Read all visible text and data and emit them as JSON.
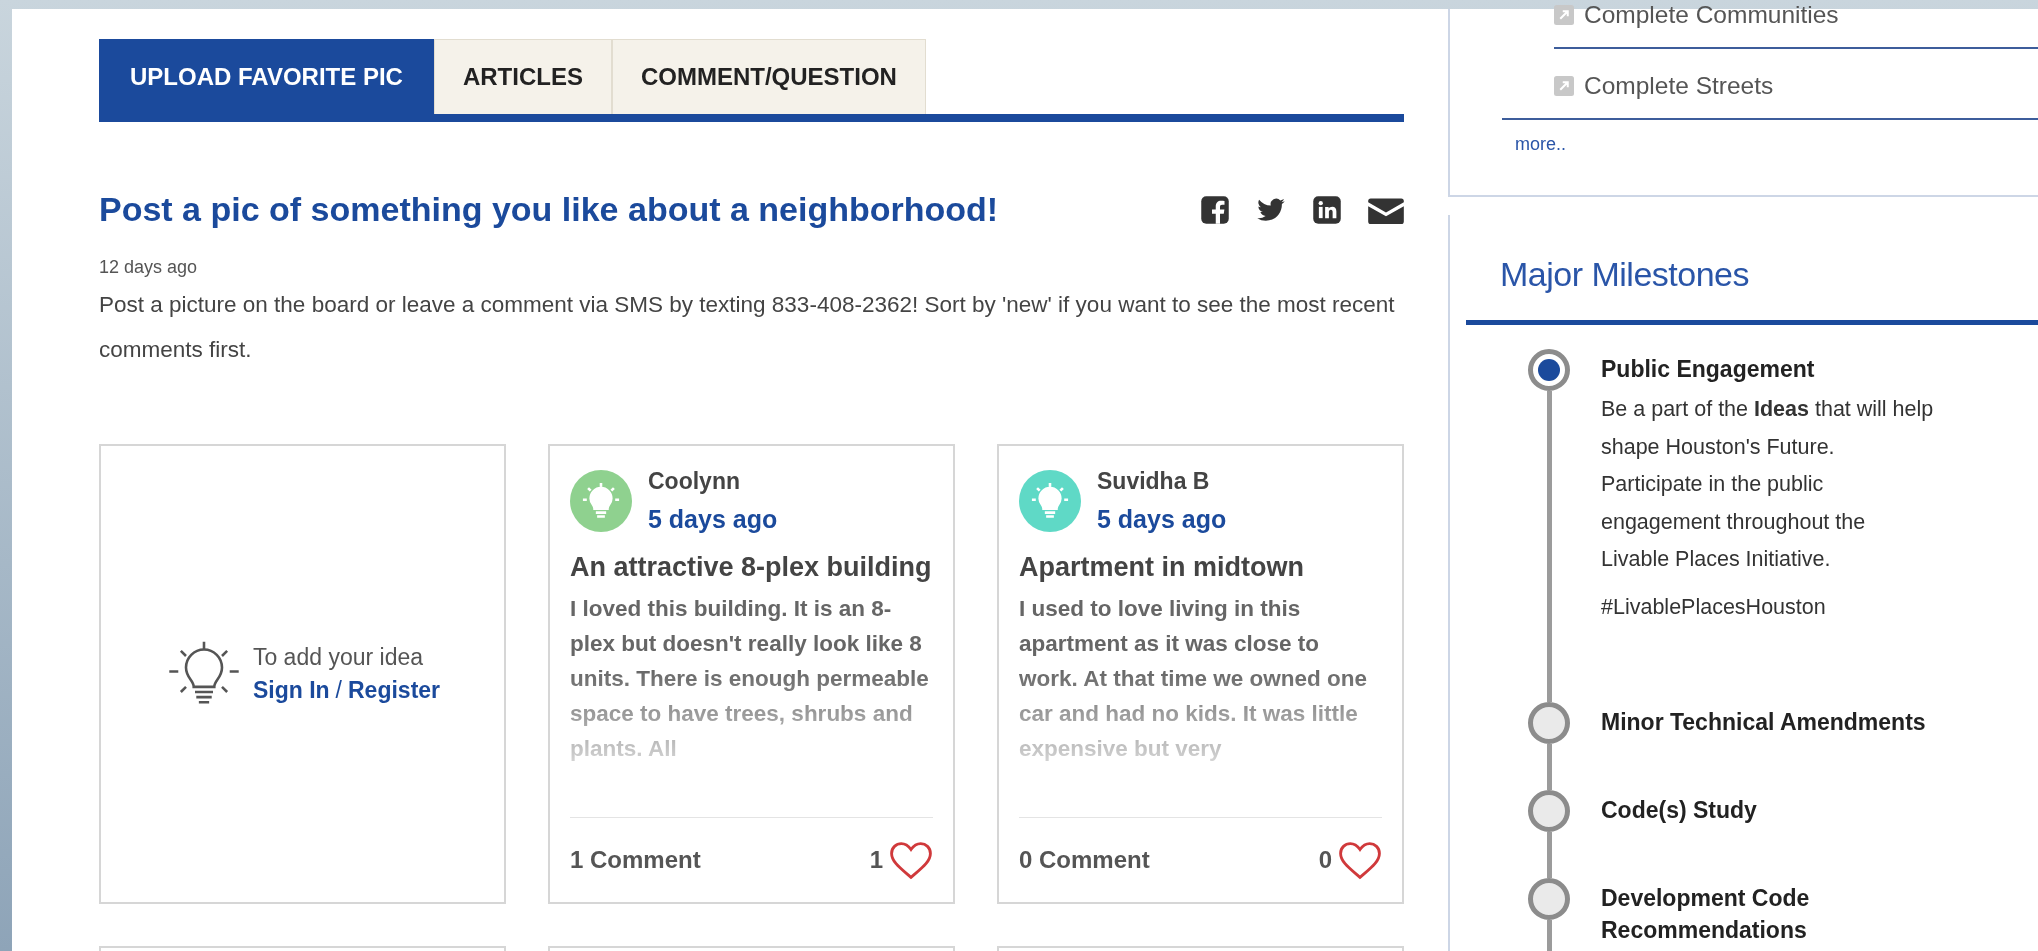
{
  "tabs": [
    {
      "label": "UPLOAD FAVORITE PIC",
      "selected": true
    },
    {
      "label": "ARTICLES",
      "selected": false
    },
    {
      "label": "COMMENT/QUESTION",
      "selected": false
    }
  ],
  "post": {
    "title": "Post a pic of something you like about a neighborhood!",
    "date": "12 days ago",
    "description": "Post a picture on the board or leave a comment via SMS by texting 833-408-2362! Sort by 'new' if you want to see the most recent comments first."
  },
  "share_icons": [
    {
      "kind": "facebook"
    },
    {
      "kind": "twitter"
    },
    {
      "kind": "linkedin"
    },
    {
      "kind": "email"
    }
  ],
  "add_idea": {
    "prompt": "To add your idea",
    "sign_in": "Sign In",
    "separator": "/",
    "register": "Register"
  },
  "ideas": [
    {
      "author": "Coolynn",
      "color": "#8fd18f",
      "time": "5 days ago",
      "title": "An attractive 8-plex building",
      "excerpt": "I loved this building. It is an 8-plex but doesn't really look like 8 units. There is enough permeable space to have trees, shrubs and plants. All",
      "comments": "1 Comment",
      "likes": "1"
    },
    {
      "author": "Suvidha B",
      "color": "#5fd9c6",
      "time": "5 days ago",
      "title": "Apartment in midtown",
      "excerpt": "I used to love living in this apartment as it was close to work. At that time we owned one car and had no kids. It was little expensive but very",
      "comments": "0 Comment",
      "likes": "0"
    }
  ],
  "sidebar": {
    "links": [
      {
        "label": "Complete Communities"
      },
      {
        "label": "Complete Streets"
      }
    ],
    "more": "more.."
  },
  "milestones": {
    "title": "Major Milestones",
    "items": [
      {
        "title": "Public Engagement",
        "current": true,
        "description": "Be a part of the **Ideas** that will help shape Houston's Future. Participate in the public engagement throughout the Livable Places Initiative.",
        "hashtag": "#LivablePlacesHouston"
      },
      {
        "title": "Minor Technical Amendments",
        "current": false
      },
      {
        "title": "Code(s) Study",
        "current": false
      },
      {
        "title": "Development Code Recommendations",
        "current": false
      }
    ]
  }
}
